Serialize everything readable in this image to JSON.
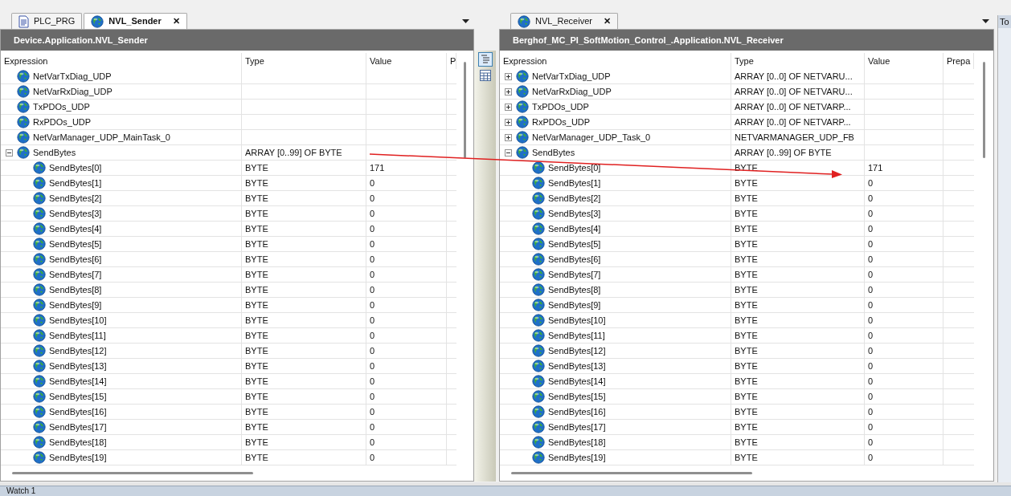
{
  "panes": [
    {
      "tabs": [
        {
          "label": "PLC_PRG",
          "kind": "program",
          "selected": false,
          "closable": false
        },
        {
          "label": "NVL_Sender",
          "kind": "list",
          "selected": true,
          "closable": true
        }
      ],
      "close_glyph": "✕",
      "title": "Device.Application.NVL_Sender",
      "columns": [
        "Expression",
        "Type",
        "Value",
        "P"
      ],
      "rows": [
        {
          "expression": "NetVarTxDiag_UDP",
          "type": "",
          "value": ""
        },
        {
          "expression": "NetVarRxDiag_UDP",
          "type": "",
          "value": ""
        },
        {
          "expression": "TxPDOs_UDP",
          "type": "",
          "value": ""
        },
        {
          "expression": "RxPDOs_UDP",
          "type": "",
          "value": ""
        },
        {
          "expression": "NetVarManager_UDP_MainTask_0",
          "type": "",
          "value": ""
        },
        {
          "expression": "SendBytes",
          "type": "ARRAY [0..99] OF BYTE",
          "value": "",
          "expanded": true,
          "children": [
            {
              "expression": "SendBytes[0]",
              "type": "BYTE",
              "value": "171"
            },
            {
              "expression": "SendBytes[1]",
              "type": "BYTE",
              "value": "0"
            },
            {
              "expression": "SendBytes[2]",
              "type": "BYTE",
              "value": "0"
            },
            {
              "expression": "SendBytes[3]",
              "type": "BYTE",
              "value": "0"
            },
            {
              "expression": "SendBytes[4]",
              "type": "BYTE",
              "value": "0"
            },
            {
              "expression": "SendBytes[5]",
              "type": "BYTE",
              "value": "0"
            },
            {
              "expression": "SendBytes[6]",
              "type": "BYTE",
              "value": "0"
            },
            {
              "expression": "SendBytes[7]",
              "type": "BYTE",
              "value": "0"
            },
            {
              "expression": "SendBytes[8]",
              "type": "BYTE",
              "value": "0"
            },
            {
              "expression": "SendBytes[9]",
              "type": "BYTE",
              "value": "0"
            },
            {
              "expression": "SendBytes[10]",
              "type": "BYTE",
              "value": "0"
            },
            {
              "expression": "SendBytes[11]",
              "type": "BYTE",
              "value": "0"
            },
            {
              "expression": "SendBytes[12]",
              "type": "BYTE",
              "value": "0"
            },
            {
              "expression": "SendBytes[13]",
              "type": "BYTE",
              "value": "0"
            },
            {
              "expression": "SendBytes[14]",
              "type": "BYTE",
              "value": "0"
            },
            {
              "expression": "SendBytes[15]",
              "type": "BYTE",
              "value": "0"
            },
            {
              "expression": "SendBytes[16]",
              "type": "BYTE",
              "value": "0"
            },
            {
              "expression": "SendBytes[17]",
              "type": "BYTE",
              "value": "0"
            },
            {
              "expression": "SendBytes[18]",
              "type": "BYTE",
              "value": "0"
            },
            {
              "expression": "SendBytes[19]",
              "type": "BYTE",
              "value": "0"
            }
          ]
        }
      ]
    },
    {
      "tabs": [
        {
          "label": "NVL_Receiver",
          "kind": "list",
          "selected": false,
          "closable": true
        }
      ],
      "close_glyph": "✕",
      "title": "Berghof_MC_PI_SoftMotion_Control_.Application.NVL_Receiver",
      "columns": [
        "Expression",
        "Type",
        "Value",
        "Prepa"
      ],
      "rows": [
        {
          "expression": "NetVarTxDiag_UDP",
          "type": "ARRAY [0..0] OF NETVARU...",
          "value": "",
          "expanded": false
        },
        {
          "expression": "NetVarRxDiag_UDP",
          "type": "ARRAY [0..0] OF NETVARU...",
          "value": "",
          "expanded": false
        },
        {
          "expression": "TxPDOs_UDP",
          "type": "ARRAY [0..0] OF NETVARP...",
          "value": "",
          "expanded": false
        },
        {
          "expression": "RxPDOs_UDP",
          "type": "ARRAY [0..0] OF NETVARP...",
          "value": "",
          "expanded": false
        },
        {
          "expression": "NetVarManager_UDP_Task_0",
          "type": "NETVARMANAGER_UDP_FB",
          "value": "",
          "expanded": false
        },
        {
          "expression": "SendBytes",
          "type": "ARRAY [0..99] OF BYTE",
          "value": "",
          "expanded": true,
          "children": [
            {
              "expression": "SendBytes[0]",
              "type": "BYTE",
              "value": "171"
            },
            {
              "expression": "SendBytes[1]",
              "type": "BYTE",
              "value": "0"
            },
            {
              "expression": "SendBytes[2]",
              "type": "BYTE",
              "value": "0"
            },
            {
              "expression": "SendBytes[3]",
              "type": "BYTE",
              "value": "0"
            },
            {
              "expression": "SendBytes[4]",
              "type": "BYTE",
              "value": "0"
            },
            {
              "expression": "SendBytes[5]",
              "type": "BYTE",
              "value": "0"
            },
            {
              "expression": "SendBytes[6]",
              "type": "BYTE",
              "value": "0"
            },
            {
              "expression": "SendBytes[7]",
              "type": "BYTE",
              "value": "0"
            },
            {
              "expression": "SendBytes[8]",
              "type": "BYTE",
              "value": "0"
            },
            {
              "expression": "SendBytes[9]",
              "type": "BYTE",
              "value": "0"
            },
            {
              "expression": "SendBytes[10]",
              "type": "BYTE",
              "value": "0"
            },
            {
              "expression": "SendBytes[11]",
              "type": "BYTE",
              "value": "0"
            },
            {
              "expression": "SendBytes[12]",
              "type": "BYTE",
              "value": "0"
            },
            {
              "expression": "SendBytes[13]",
              "type": "BYTE",
              "value": "0"
            },
            {
              "expression": "SendBytes[14]",
              "type": "BYTE",
              "value": "0"
            },
            {
              "expression": "SendBytes[15]",
              "type": "BYTE",
              "value": "0"
            },
            {
              "expression": "SendBytes[16]",
              "type": "BYTE",
              "value": "0"
            },
            {
              "expression": "SendBytes[17]",
              "type": "BYTE",
              "value": "0"
            },
            {
              "expression": "SendBytes[18]",
              "type": "BYTE",
              "value": "0"
            },
            {
              "expression": "SendBytes[19]",
              "type": "BYTE",
              "value": "0"
            }
          ]
        }
      ]
    }
  ],
  "side_tab": {
    "label": "To"
  },
  "bottom_panel": {
    "label": "Watch 1"
  }
}
